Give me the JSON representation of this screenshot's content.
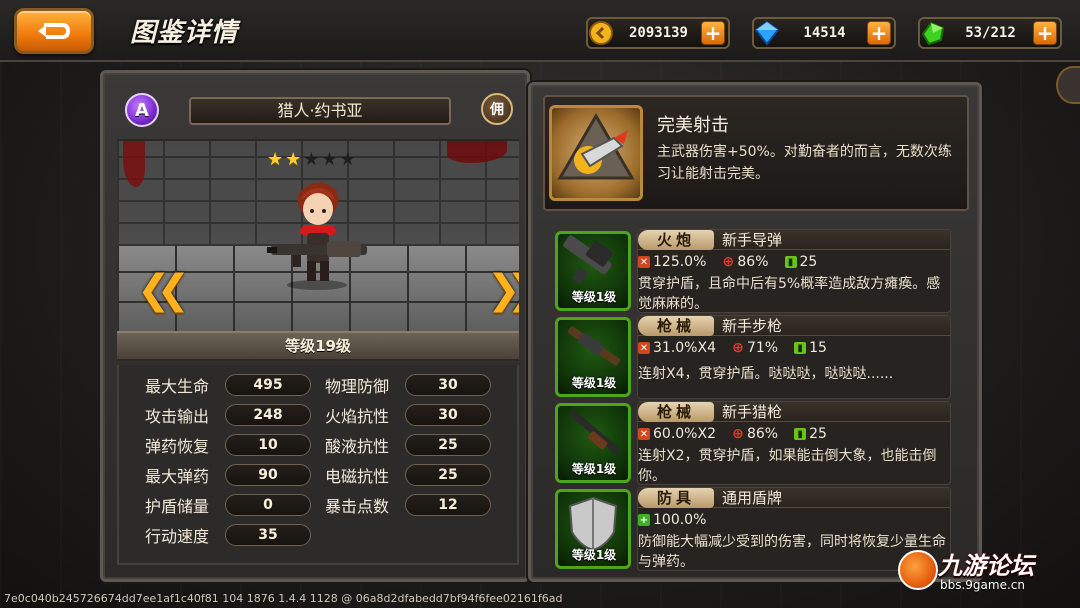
{
  "header": {
    "title": "图鉴详情",
    "back_icon": "return-arrow-icon",
    "currencies": [
      {
        "name": "gold",
        "icon": "gold-coin-icon",
        "value": "2093139",
        "plus": "+"
      },
      {
        "name": "diamond",
        "icon": "blue-diamond-icon",
        "value": "14514",
        "plus": "+"
      },
      {
        "name": "stamina",
        "icon": "green-crystal-icon",
        "value": "53/212",
        "plus": "+"
      }
    ]
  },
  "character": {
    "rank_badge": "A",
    "name": "猎人·约书亚",
    "type_badge": "佣",
    "stars_filled": 2,
    "stars_total": 5,
    "level": "等级19级",
    "stats": [
      {
        "label": "最大生命",
        "value": "495"
      },
      {
        "label": "物理防御",
        "value": "30"
      },
      {
        "label": "攻击输出",
        "value": "248"
      },
      {
        "label": "火焰抗性",
        "value": "30"
      },
      {
        "label": "弹药恢复",
        "value": "10"
      },
      {
        "label": "酸液抗性",
        "value": "25"
      },
      {
        "label": "最大弹药",
        "value": "90"
      },
      {
        "label": "电磁抗性",
        "value": "25"
      },
      {
        "label": "护盾储量",
        "value": "0"
      },
      {
        "label": "暴击点数",
        "value": "12"
      },
      {
        "label": "行动速度",
        "value": "35"
      }
    ]
  },
  "skill": {
    "icon": "bullet-skill-icon",
    "title": "完美射击",
    "description": "主武器伤害+50%。对勤奋者的而言，无数次练习让能射击完美。"
  },
  "weapons": [
    {
      "category": "火炮",
      "name": "新手导弹",
      "icon": "rocket-launcher-icon",
      "level": "等级1级",
      "damage": "125.0%",
      "accuracy": "86%",
      "ammo": "25",
      "description": "贯穿护盾，且命中后有5%概率造成敌方瘫痪。感觉麻麻的。"
    },
    {
      "category": "枪械",
      "name": "新手步枪",
      "icon": "rifle-icon",
      "level": "等级1级",
      "damage": "31.0%X4",
      "accuracy": "71%",
      "ammo": "15",
      "description": "连射X4，贯穿护盾。哒哒哒，哒哒哒......"
    },
    {
      "category": "枪械",
      "name": "新手猎枪",
      "icon": "shotgun-icon",
      "level": "等级1级",
      "damage": "60.0%X2",
      "accuracy": "86%",
      "ammo": "25",
      "description": "连射X2，贯穿护盾，如果能击倒大象，也能击倒你。"
    },
    {
      "category": "防具",
      "name": "通用盾牌",
      "icon": "shield-armor-icon",
      "level": "等级1级",
      "defense": "100.0%",
      "description": "防御能大幅减少受到的伤害，同时将恢复少量生命与弹药。"
    }
  ],
  "footer": {
    "hash": "7e0c040b245726674dd7ee1af1c40f81 104 1876 1.4.4 1128 @ 06a8d2dfabedd7bf94f6fee02161f6ad"
  },
  "watermark": {
    "title": "九游论坛",
    "url": "bbs.9game.cn"
  },
  "colors": {
    "accent_orange": "#f07b0c",
    "star_gold": "#ffcf2e",
    "weapon_frame_green": "#4ea51a",
    "panel_border": "#5e5852"
  }
}
